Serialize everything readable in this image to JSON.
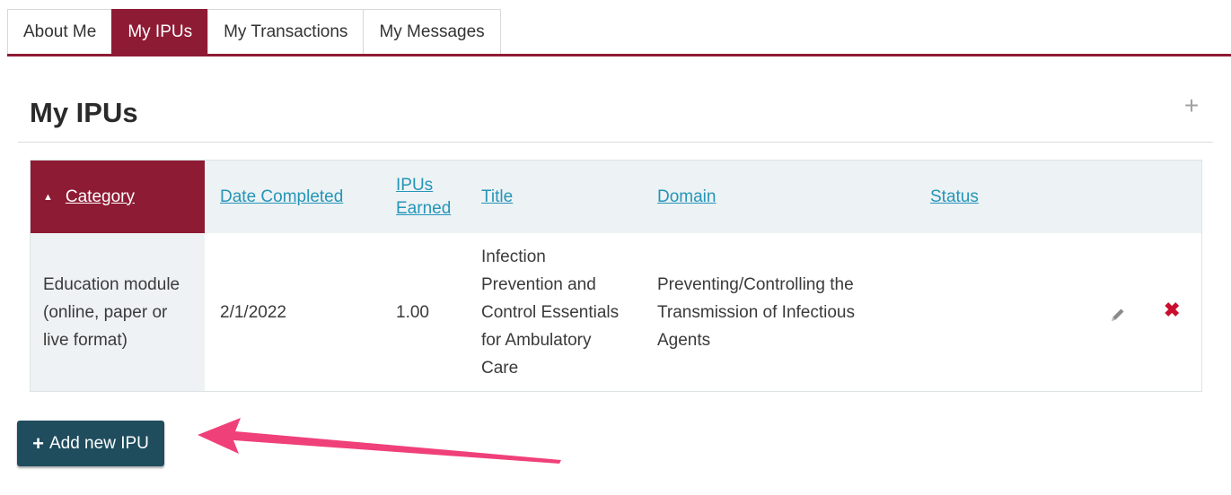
{
  "tabs": [
    {
      "label": "About Me",
      "active": false
    },
    {
      "label": "My IPUs",
      "active": true
    },
    {
      "label": "My Transactions",
      "active": false
    },
    {
      "label": "My Messages",
      "active": false
    }
  ],
  "page_title": "My IPUs",
  "table": {
    "headers": {
      "category": "Category",
      "date_completed": "Date Completed",
      "ipus_earned_line1": "IPUs",
      "ipus_earned_line2": "Earned",
      "title": "Title",
      "domain": "Domain",
      "status": "Status"
    },
    "sort_column": "Category",
    "rows": [
      {
        "category_lines": [
          "Education module",
          "(online, paper or",
          "live format)"
        ],
        "date_completed": "2/1/2022",
        "ipus_earned": "1.00",
        "title_lines": [
          "Infection",
          "Prevention and",
          "Control Essentials",
          "for Ambulatory",
          "Care"
        ],
        "domain_lines": [
          "Preventing/Controlling the",
          "Transmission of Infectious",
          "Agents"
        ],
        "status": ""
      }
    ]
  },
  "add_button": {
    "label": "Add new IPU"
  },
  "colors": {
    "brand_maroon": "#8e1b34",
    "link_blue": "#2495b8",
    "button_teal": "#1f4d5e",
    "annotation_arrow": "#f0407a",
    "delete_red": "#c8102e"
  },
  "icons": [
    "plus-icon",
    "sort-ascending-icon",
    "pencil-icon",
    "delete-x-icon",
    "annotation-arrow"
  ]
}
